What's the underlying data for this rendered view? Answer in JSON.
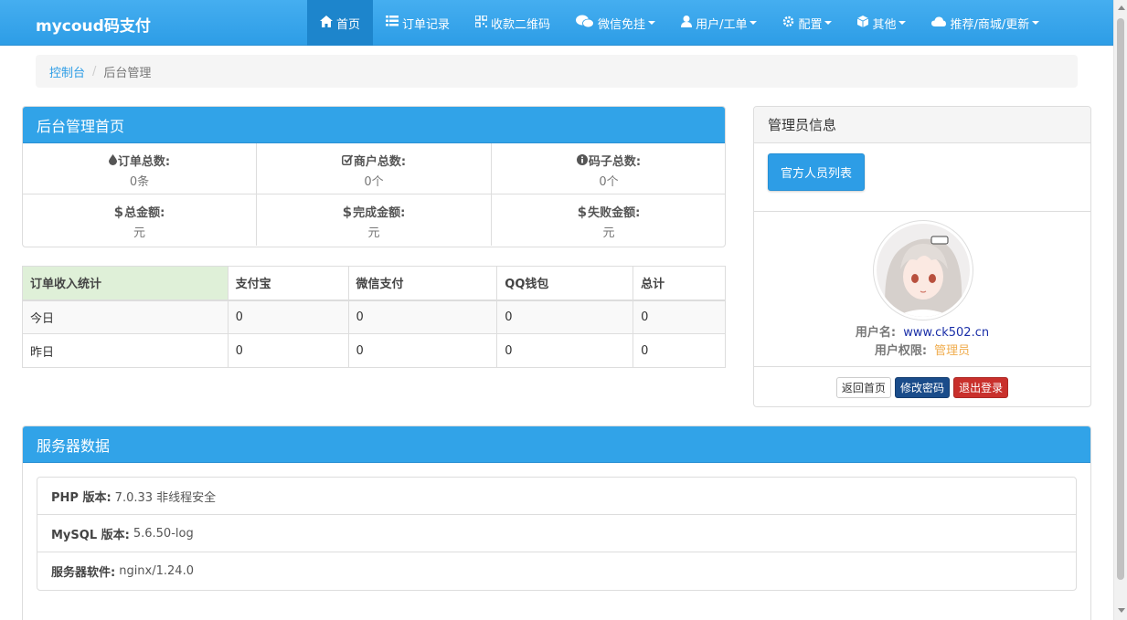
{
  "navbar": {
    "brand": "mycoud码支付",
    "items": [
      {
        "label": "首页",
        "icon": "home-icon"
      },
      {
        "label": "订单记录",
        "icon": "list-icon"
      },
      {
        "label": "收款二维码",
        "icon": "qrcode-icon"
      },
      {
        "label": "微信免挂",
        "icon": "wechat-icon"
      },
      {
        "label": "用户/工单",
        "icon": "user-icon"
      },
      {
        "label": "配置",
        "icon": "gear-icon"
      },
      {
        "label": "其他",
        "icon": "cube-icon"
      },
      {
        "label": "推荐/商城/更新",
        "icon": "cloud-icon"
      }
    ]
  },
  "breadcrumb": {
    "home": "控制台",
    "current": "后台管理"
  },
  "dashboard": {
    "title": "后台管理首页",
    "stats": [
      {
        "icon": "drop-icon",
        "label": "订单总数:",
        "value": "0条"
      },
      {
        "icon": "check-square-icon",
        "label": "商户总数:",
        "value": "0个"
      },
      {
        "icon": "info-circle-icon",
        "label": "码子总数:",
        "value": "0个"
      },
      {
        "icon": "dollar-icon",
        "label": "总金额:",
        "value": "元"
      },
      {
        "icon": "dollar-icon",
        "label": "完成金额:",
        "value": "元"
      },
      {
        "icon": "dollar-icon",
        "label": "失败金额:",
        "value": "元"
      }
    ]
  },
  "income_table": {
    "headers": [
      "订单收入统计",
      "支付宝",
      "微信支付",
      "QQ钱包",
      "总计"
    ],
    "rows": [
      [
        "今日",
        "0",
        "0",
        "0",
        "0"
      ],
      [
        "昨日",
        "0",
        "0",
        "0",
        "0"
      ]
    ]
  },
  "admin": {
    "title": "管理员信息",
    "staff_list_button": "官方人员列表",
    "username_label": "用户名:",
    "username": "www.ck502.cn",
    "role_label": "用户权限:",
    "role": "管理员",
    "buttons": {
      "home": "返回首页",
      "password": "修改密码",
      "logout": "退出登录"
    }
  },
  "server": {
    "title": "服务器数据",
    "items": [
      {
        "label": "PHP 版本:",
        "value": "7.0.33 非线程安全"
      },
      {
        "label": "MySQL 版本:",
        "value": "5.6.50-log"
      },
      {
        "label": "服务器软件:",
        "value": "nginx/1.24.0"
      }
    ]
  },
  "colors": {
    "primary": "#31a3e8",
    "navbar_active": "#1d85cc",
    "username": "#1a2fa8",
    "role": "#f0ad4e"
  }
}
